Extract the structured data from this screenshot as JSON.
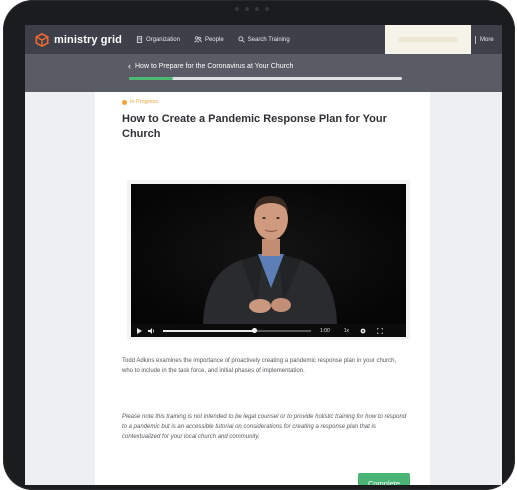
{
  "app": {
    "brand_name": "ministry grid",
    "brand_color": "#f26a30"
  },
  "topnav": {
    "items": [
      {
        "label": "Organization",
        "icon": "building-icon"
      },
      {
        "label": "People",
        "icon": "people-icon"
      },
      {
        "label": "Search Training",
        "icon": "search-icon"
      }
    ],
    "more_label": "More"
  },
  "course": {
    "title": "How to Prepare for the Coronavirus at Your Church",
    "progress_fraction": 0.16,
    "progress_color": "#4aba73"
  },
  "lesson": {
    "status": "In Progress",
    "status_color": "#f0a436",
    "title": "How to Create a Pandemic Response Plan for Your Church",
    "video": {
      "current_time": "1:00",
      "speed": "1x",
      "played_fraction": 0.62
    },
    "description": "Todd Adkins examines the importance of proactively creating a pandemic response plan in your church, who to include in the task force, and initial phases of implementation.",
    "note": "Please note this training is not intended to be legal counsel or to provide holistic training for how to respond to a pandemic but is an accessible tutorial on considerations for creating a response plan that is contextualized for your local church and community.",
    "complete_label": "Complete",
    "complete_color": "#4ab475"
  }
}
